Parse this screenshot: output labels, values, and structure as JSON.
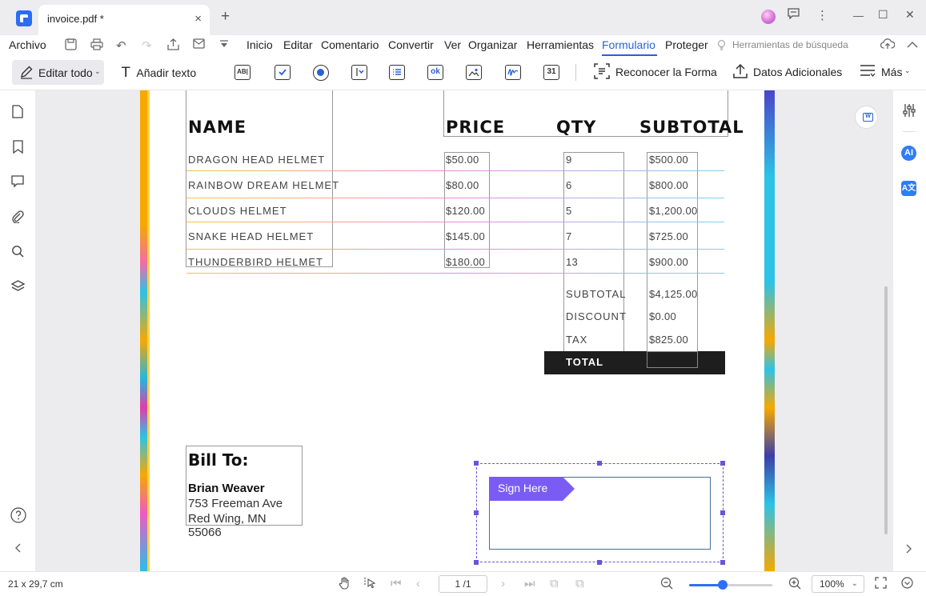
{
  "tab": {
    "title": "invoice.pdf *",
    "close": "×",
    "new": "+"
  },
  "window": {
    "minimize": "—",
    "maximize": "☐",
    "close": "✕"
  },
  "menu": {
    "file": "Archivo",
    "items": [
      "Inicio",
      "Editar",
      "Comentario",
      "Convertir",
      "Ver",
      "Organizar",
      "Herramientas",
      "Formulario",
      "Proteger"
    ],
    "active": "Formulario",
    "search_tools": "Herramientas de búsqueda"
  },
  "toolbar": {
    "edit_all": "Editar todo",
    "add_text": "Añadir texto",
    "recognize_form": "Reconocer la Forma",
    "additional_data": "Datos Adicionales",
    "more": "Más",
    "field_icons": [
      "text-field",
      "checkbox",
      "radio-button",
      "combo-box",
      "list-box",
      "push-button",
      "image-field",
      "signature-field",
      "date-field"
    ]
  },
  "invoice": {
    "headers": {
      "name": "NAME",
      "price": "PRICE",
      "qty": "QTY",
      "subtotal": "SUBTOTAL"
    },
    "rows": [
      {
        "name": "DRAGON HEAD HELMET",
        "price": "$50.00",
        "qty": "9",
        "subtotal": "$500.00"
      },
      {
        "name": "RAINBOW DREAM HELMET",
        "price": "$80.00",
        "qty": "6",
        "subtotal": "$800.00"
      },
      {
        "name": "CLOUDS HELMET",
        "price": "$120.00",
        "qty": "5",
        "subtotal": "$1,200.00"
      },
      {
        "name": "SNAKE HEAD HELMET",
        "price": "$145.00",
        "qty": "7",
        "subtotal": "$725.00"
      },
      {
        "name": "THUNDERBIRD HELMET",
        "price": "$180.00",
        "qty": "13",
        "subtotal": "$900.00"
      }
    ],
    "summary": [
      {
        "label": "SUBTOTAL",
        "value": "$4,125.00"
      },
      {
        "label": "DISCOUNT",
        "value": "$0.00"
      },
      {
        "label": "TAX",
        "value": "$825.00"
      }
    ],
    "total_label": "TOTAL",
    "bill_to": {
      "heading": "Bill To:",
      "name": "Brian Weaver",
      "address1": "753 Freeman Ave",
      "address2": "Red Wing, MN 55066"
    },
    "sign_here": "Sign Here"
  },
  "status": {
    "page_size": "21 x 29,7 cm",
    "page_indicator": "1 /1",
    "zoom": "100%",
    "zoom_level_fraction": 0.4
  },
  "colors": {
    "accent": "#2b5fd9",
    "signature": "#7a5cf5",
    "total_bar": "#1e1e1e"
  }
}
